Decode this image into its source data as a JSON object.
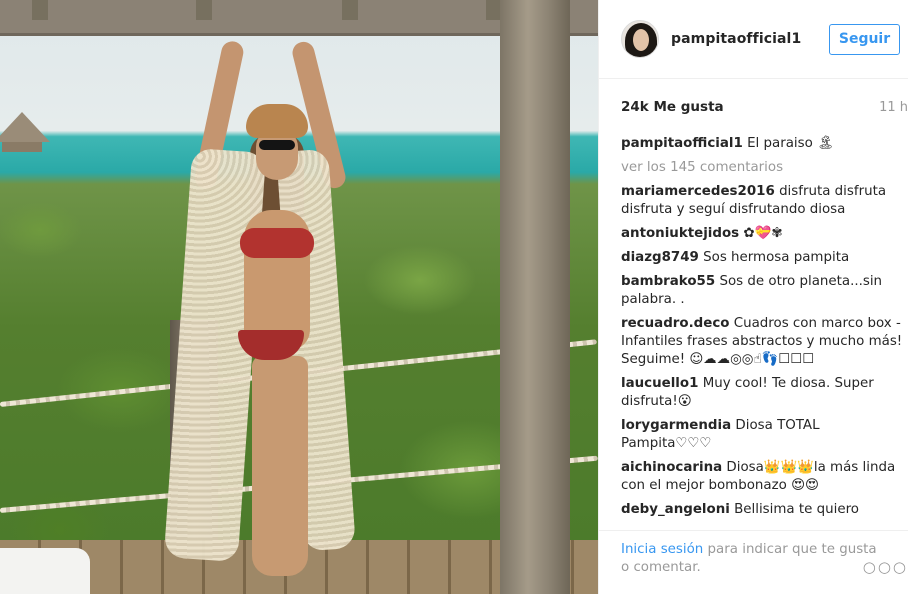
{
  "post": {
    "username": "pampitaofficial1",
    "follow_label": "Seguir",
    "likes": "24k Me gusta",
    "time": "11 h",
    "caption_user": "pampitaofficial1",
    "caption_text": "El paraiso 🏝",
    "view_comments": "ver los 145 comentarios"
  },
  "comments": [
    {
      "user": "mariamercedes2016",
      "text": "disfruta disfruta disfruta y seguí disfrutando diosa"
    },
    {
      "user": "antoniuktejidos",
      "text": "✿💝✾"
    },
    {
      "user": "diazg8749",
      "text": "Sos hermosa pampita"
    },
    {
      "user": "bambrako55",
      "text": "Sos de otro planeta...sin palabra. ."
    },
    {
      "user": "recuadro.deco",
      "text": "Cuadros con marco box - Infantiles frases abstractos y mucho más! Seguime! ☺☁☁◎◎☝👣☐☐☐"
    },
    {
      "user": "laucuello1",
      "text": "Muy cool! Te diosa. Super disfruta!😮"
    },
    {
      "user": "lorygarmendia",
      "text": "Diosa TOTAL Pampita♡♡♡"
    },
    {
      "user": "aichinocarina",
      "text": "Diosa👑👑👑la más linda con el mejor bombonazo 😍😍"
    },
    {
      "user": "deby_angeloni",
      "text": "Bellisima te quiero"
    }
  ],
  "footer": {
    "login_link": "Inicia sesión",
    "login_text": " para indicar que te gusta o comentar."
  },
  "icons": {
    "more": "more-options-icon"
  },
  "colors": {
    "accent": "#3897f0",
    "muted": "#999999"
  }
}
